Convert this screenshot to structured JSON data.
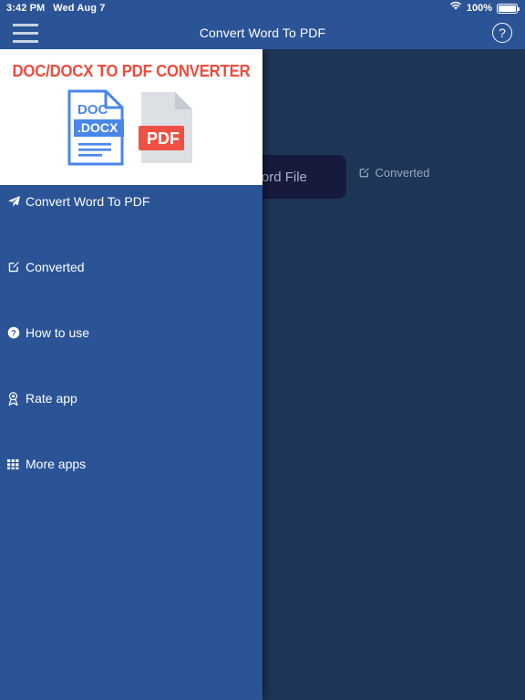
{
  "status_bar": {
    "time": "3:42 PM",
    "date": "Wed Aug 7",
    "wifi_icon": "wifi-icon",
    "battery_percent": "100%",
    "battery_icon": "battery-full-icon"
  },
  "navbar": {
    "menu_icon": "hamburger-menu-icon",
    "title": "Convert Word To PDF",
    "help_icon": "help-circle-icon",
    "help_label": "?",
    "background_color": "#2b5496"
  },
  "drawer": {
    "background_color": "#2b5496",
    "header": {
      "background_color": "#ffffff",
      "brand_title": "DOC/DOCX TO PDF CONVERTER",
      "brand_title_color": "#ef4b3c",
      "doc_icon": {
        "name": "doc-docx-file-icon",
        "top_label": "DOC",
        "band_label": ".DOCX",
        "color": "#4a86e8"
      },
      "pdf_icon": {
        "name": "pdf-file-icon",
        "band_label": "PDF",
        "page_color": "#dcdfe4",
        "band_color": "#ef5044"
      }
    },
    "items": [
      {
        "label": "Convert Word To PDF",
        "icon": "paper-plane-icon"
      },
      {
        "label": "Converted",
        "icon": "pencil-square-icon"
      },
      {
        "label": "How to use",
        "icon": "question-circle-icon"
      },
      {
        "label": "Rate app",
        "icon": "award-ribbon-icon"
      },
      {
        "label": "More apps",
        "icon": "grid-apps-icon"
      }
    ]
  },
  "main": {
    "background_color": "#1d3557",
    "converted_label": "Converted",
    "converted_icon": "pencil-square-icon",
    "pick_file_button": "Select Word File",
    "pick_file_button_color": "#161b3d"
  }
}
